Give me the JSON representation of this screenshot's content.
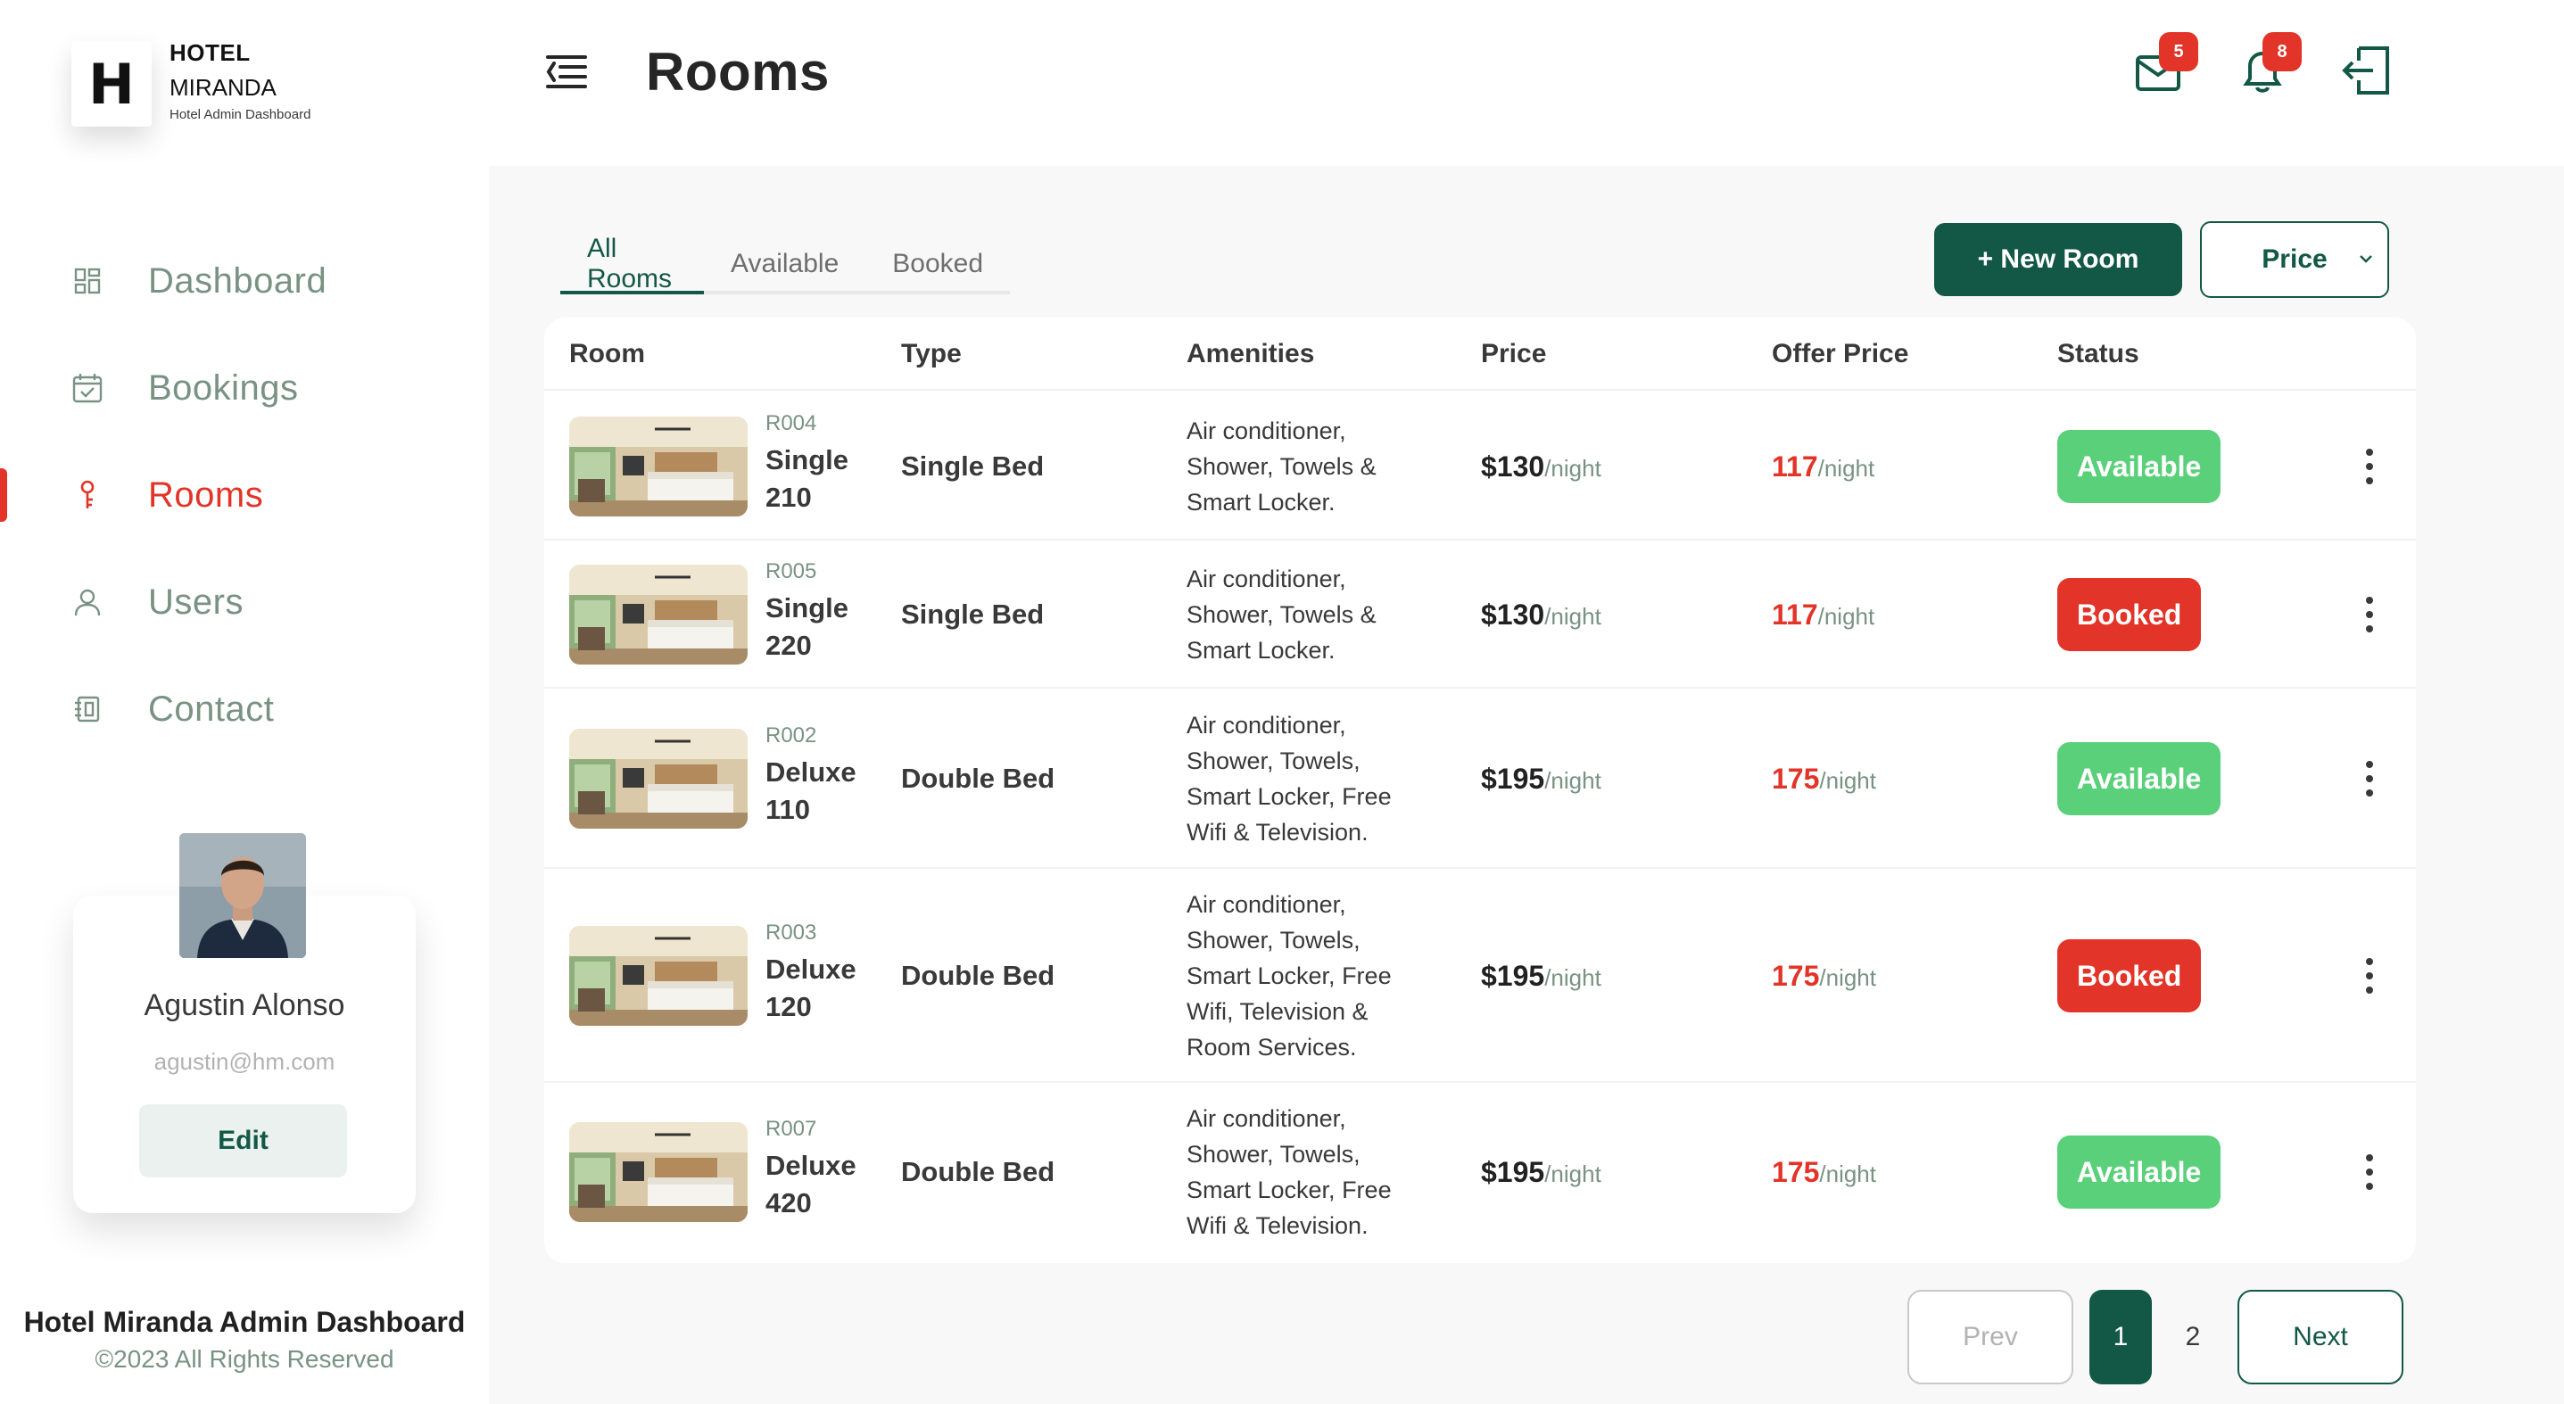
{
  "brand": {
    "initial": "H",
    "line1": "HOTEL",
    "line2": "MIRANDA",
    "line3": "Hotel Admin Dashboard"
  },
  "nav": [
    {
      "label": "Dashboard",
      "icon": "dashboard-icon"
    },
    {
      "label": "Bookings",
      "icon": "calendar-check-icon"
    },
    {
      "label": "Rooms",
      "icon": "key-icon",
      "active": true
    },
    {
      "label": "Users",
      "icon": "user-icon"
    },
    {
      "label": "Contact",
      "icon": "contact-book-icon"
    }
  ],
  "user": {
    "name": "Agustin Alonso",
    "email": "agustin@hm.com",
    "edit_label": "Edit"
  },
  "footer": {
    "title": "Hotel Miranda Admin Dashboard",
    "copyright": "©2023 All Rights Reserved"
  },
  "header": {
    "title": "Rooms",
    "mail_count": "5",
    "notif_count": "8"
  },
  "tabs": [
    "All Rooms",
    "Available",
    "Booked"
  ],
  "toolbar": {
    "new_room_label": "+ New Room",
    "sort_label": "Price"
  },
  "table": {
    "columns": [
      "Room",
      "Type",
      "Amenities",
      "Price",
      "Offer Price",
      "Status"
    ],
    "unit": "/night",
    "rows": [
      {
        "id": "R004",
        "name_l1": "Single",
        "name_l2": "210",
        "type": "Single Bed",
        "amenities": [
          "Air conditioner,",
          "Shower, Towels &",
          "Smart Locker."
        ],
        "price": "$130",
        "offer": "117",
        "status": "Available"
      },
      {
        "id": "R005",
        "name_l1": "Single",
        "name_l2": "220",
        "type": "Single Bed",
        "amenities": [
          "Air conditioner,",
          "Shower, Towels &",
          "Smart Locker."
        ],
        "price": "$130",
        "offer": "117",
        "status": "Booked"
      },
      {
        "id": "R002",
        "name_l1": "Deluxe",
        "name_l2": "110",
        "type": "Double Bed",
        "amenities": [
          "Air conditioner,",
          "Shower, Towels,",
          "Smart Locker, Free",
          "Wifi & Television."
        ],
        "price": "$195",
        "offer": "175",
        "status": "Available"
      },
      {
        "id": "R003",
        "name_l1": "Deluxe",
        "name_l2": "120",
        "type": "Double Bed",
        "amenities": [
          "Air conditioner,",
          "Shower, Towels,",
          "Smart Locker, Free",
          "Wifi, Television &",
          "Room Services."
        ],
        "price": "$195",
        "offer": "175",
        "status": "Booked"
      },
      {
        "id": "R007",
        "name_l1": "Deluxe",
        "name_l2": "420",
        "type": "Double Bed",
        "amenities": [
          "Air conditioner,",
          "Shower, Towels,",
          "Smart Locker, Free",
          "Wifi & Television."
        ],
        "price": "$195",
        "offer": "175",
        "status": "Available"
      }
    ]
  },
  "pagination": {
    "prev": "Prev",
    "pages": [
      "1",
      "2"
    ],
    "current": "1",
    "next": "Next"
  },
  "colors": {
    "primary": "#135846",
    "accent": "#E23428",
    "available": "#5AD07A",
    "muted": "#799283"
  }
}
